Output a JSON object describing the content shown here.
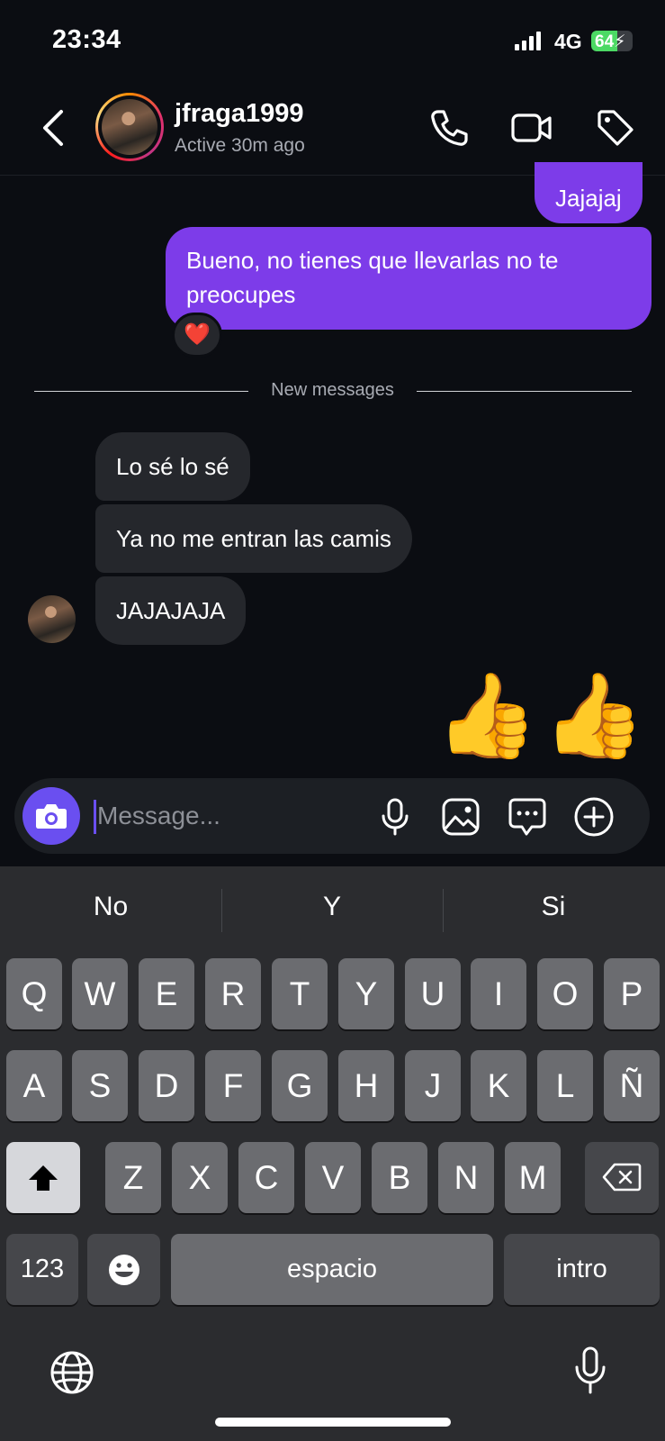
{
  "status_bar": {
    "time": "23:34",
    "network": "4G",
    "battery": "64",
    "battery_level": 0.64
  },
  "header": {
    "username": "jfraga1999",
    "status": "Active 30m ago",
    "icons": [
      "chevron-left-icon",
      "phone-icon",
      "video-camera-icon",
      "tag-icon"
    ]
  },
  "messages": {
    "outgoing": [
      {
        "text": "Jajajaj"
      },
      {
        "text": "Bueno, no tienes que llevarlas no te",
        "text2": "preocupes",
        "reaction": "❤️"
      }
    ],
    "divider": "New messages",
    "incoming": [
      {
        "text": "Lo sé lo sé"
      },
      {
        "text": "Ya no me entran las camis"
      },
      {
        "text": "JAJAJAJA"
      }
    ],
    "big_emoji": "👍👍"
  },
  "composer": {
    "placeholder": "Message...",
    "icons": [
      "camera-icon",
      "microphone-icon",
      "image-icon",
      "chat-bubble-icon",
      "plus-circle-icon"
    ]
  },
  "keyboard": {
    "suggestions": [
      "No",
      "Y",
      "Si"
    ],
    "row1": [
      "Q",
      "W",
      "E",
      "R",
      "T",
      "Y",
      "U",
      "I",
      "O",
      "P"
    ],
    "row2": [
      "A",
      "S",
      "D",
      "F",
      "G",
      "H",
      "J",
      "K",
      "L",
      "Ñ"
    ],
    "row3": [
      "Z",
      "X",
      "C",
      "V",
      "B",
      "N",
      "M"
    ],
    "numbers_label": "123",
    "space_label": "espacio",
    "return_label": "intro",
    "bottom_icons": [
      "globe-icon",
      "dictation-microphone-icon"
    ]
  }
}
